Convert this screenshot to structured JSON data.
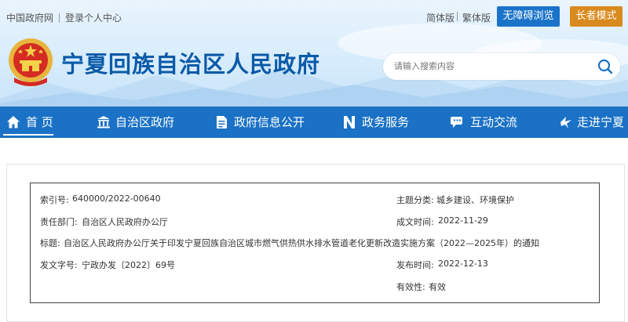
{
  "top_links": {
    "gov_portal": "中国政府网",
    "login": "登录个人中心"
  },
  "lang": {
    "simplified": "简体版",
    "traditional": "繁体版"
  },
  "buttons": {
    "accessible": "无障碍浏览",
    "elder": "长者模式"
  },
  "site_title": "宁夏回族自治区人民政府",
  "search": {
    "placeholder": "请输入搜索内容"
  },
  "nav": [
    {
      "label": "首 页",
      "icon": "home-icon"
    },
    {
      "label": "自治区政府",
      "icon": "government-building-icon"
    },
    {
      "label": "政府信息公开",
      "icon": "document-icon"
    },
    {
      "label": "政务服务",
      "icon": "service-n-icon"
    },
    {
      "label": "互动交流",
      "icon": "chat-icon"
    },
    {
      "label": "走进宁夏",
      "icon": "bird-icon"
    }
  ],
  "info": {
    "index_label": "索引号:",
    "index_value": "640000/2022-00640",
    "category_label": "主题分类:",
    "category_value": "城乡建设、环境保护",
    "dept_label": "责任部门:",
    "dept_value": "自治区人民政府办公厅",
    "created_label": "成文时间:",
    "created_value": "2022-11-29",
    "title_label": "标题:",
    "title_value": "自治区人民政府办公厅关于印发宁夏回族自治区城市燃气供热供水排水管道老化更新改造实施方案（2022—2025年）的通知",
    "docno_label": "发文字号:",
    "docno_value": "宁政办发〔2022〕69号",
    "published_label": "发布时间:",
    "published_value": "2022-12-13",
    "validity_label": "有效性:",
    "validity_value": "有效"
  },
  "colors": {
    "nav_bg": "#1a71c5",
    "title": "#0a5aa8",
    "accessible_btn": "#1a73c9",
    "elder_btn": "#d98a1e"
  }
}
